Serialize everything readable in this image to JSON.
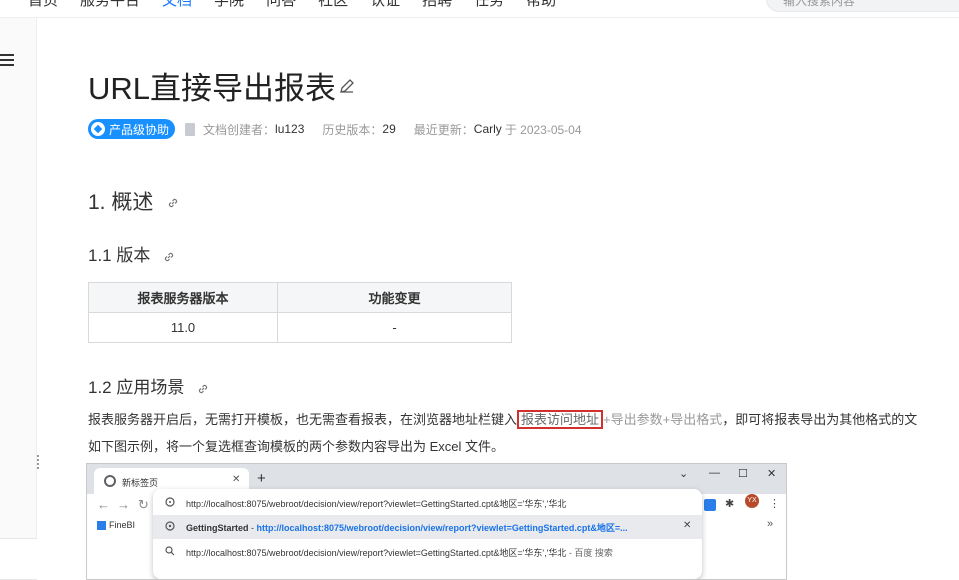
{
  "topnav": {
    "items": [
      "首页",
      "服务平台",
      "文档",
      "学院",
      "问答",
      "社区",
      "认证",
      "招聘",
      "任务",
      "帮助"
    ],
    "active_index": 2,
    "search_placeholder": "输入搜索内容"
  },
  "doc": {
    "title": "URL直接导出报表",
    "badge": "产品级协助",
    "creator_label": "文档创建者：",
    "creator": "lu123",
    "history_label": "历史版本：",
    "history": "29",
    "updated_label": "最近更新：",
    "updated_by": "Carly",
    "updated_at": "于 2023-05-04"
  },
  "sections": {
    "h1": "1. 概述",
    "h2a": "1.1 版本",
    "h2b": "1.2 应用场景"
  },
  "table": {
    "headers": [
      "报表服务器版本",
      "功能变更"
    ],
    "rows": [
      [
        "11.0",
        "-"
      ]
    ]
  },
  "paragraph": {
    "before": "报表服务器开启后，无需打开模板，也无需查看报表，在浏览器地址栏键入",
    "highlight": "报表访问地址",
    "after_muted": "+导出参数+导出格式",
    "after": "，即可将报表导出为其他格式的文",
    "line2": "如下图示例，将一个复选框查询模板的两个参数内容导出为 Excel 文件。"
  },
  "browser": {
    "tab_label": "新标签页",
    "new_tab": "+",
    "bookmark": "FineBI",
    "more": "»",
    "avatar": "YX",
    "omnibox": {
      "input": "http://localhost:8075/webroot/decision/view/report?viewlet=GettingStarted.cpt&地区='华东','华北",
      "suggest_title": "GettingStarted",
      "suggest_sep": " - ",
      "suggest_url": "http://localhost:8075/webroot/decision/view/report?viewlet=GettingStarted.cpt&地区=...",
      "search_query": "http://localhost:8075/webroot/decision/view/report?viewlet=GettingStarted.cpt&地区='华东','华北",
      "search_suffix": " - 百度 搜索"
    }
  },
  "colors": {
    "accent": "#1890ff",
    "highlight_border": "#d32f2f",
    "link_blue": "#1a73e8"
  }
}
